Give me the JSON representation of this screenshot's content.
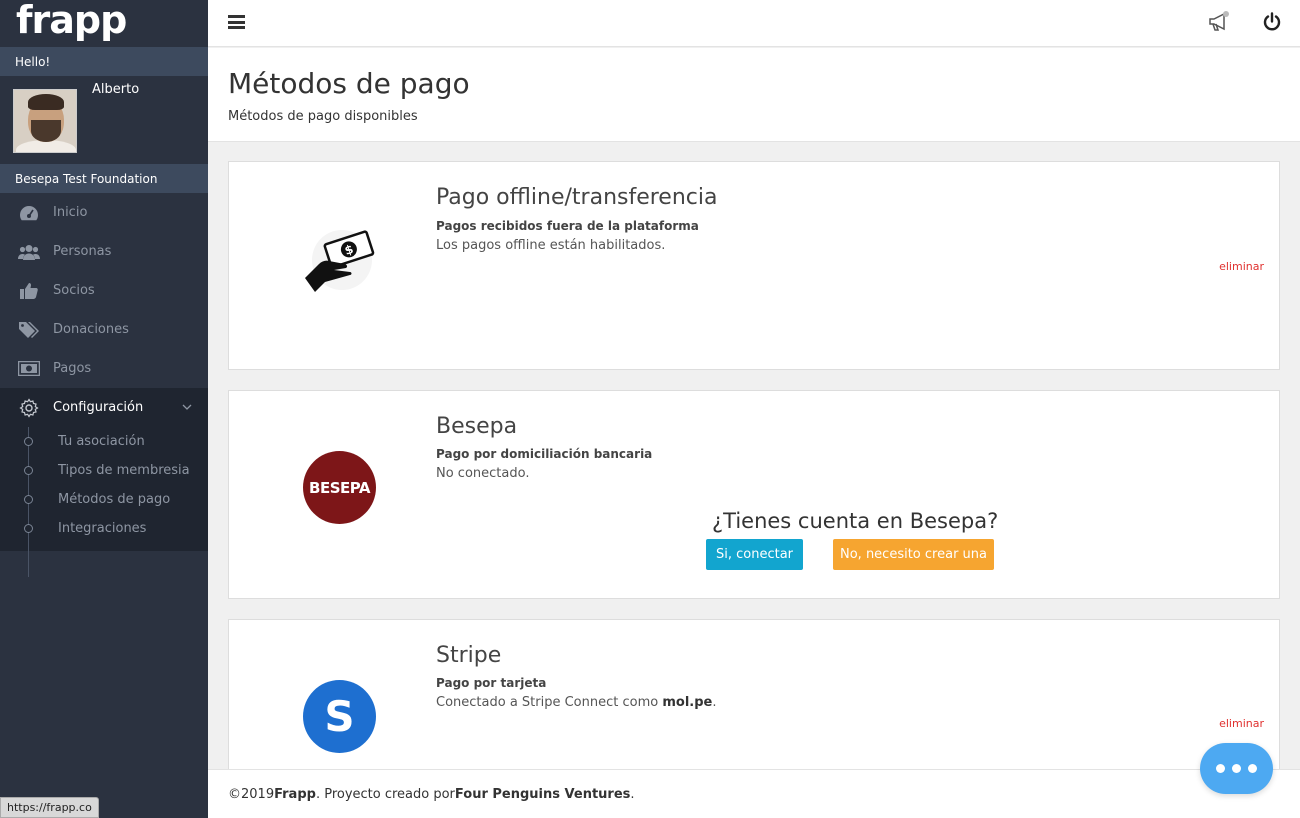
{
  "app": {
    "logo_text": "frapp",
    "hello": "Hello!",
    "user_name": "Alberto",
    "organization": "Besepa Test Foundation"
  },
  "sidebar": {
    "items": [
      {
        "label": "Inicio",
        "icon": "dashboard-icon"
      },
      {
        "label": "Personas",
        "icon": "users-icon"
      },
      {
        "label": "Socios",
        "icon": "thumbs-up-icon"
      },
      {
        "label": "Donaciones",
        "icon": "tags-icon"
      },
      {
        "label": "Pagos",
        "icon": "money-icon"
      },
      {
        "label": "Configuración",
        "icon": "gear-icon"
      }
    ],
    "subitems": [
      {
        "label": "Tu asociación"
      },
      {
        "label": "Tipos de membresia"
      },
      {
        "label": "Métodos de pago"
      },
      {
        "label": "Integraciones"
      }
    ]
  },
  "header": {
    "title": "Métodos de pago",
    "subtitle": "Métodos de pago disponibles"
  },
  "cards": {
    "offline": {
      "title": "Pago offline/transferencia",
      "subtitle": "Pagos recibidos fuera de la plataforma",
      "description": "Los pagos offline están habilitados.",
      "delete_label": "eliminar"
    },
    "besepa": {
      "title": "Besepa",
      "subtitle": "Pago por domiciliación bancaria",
      "description": "No conectado.",
      "logo_text": "BESEPA",
      "question": "¿Tienes cuenta en Besepa?",
      "yes_label": "Si, conectar",
      "no_label": "No, necesito crear una"
    },
    "stripe": {
      "title": "Stripe",
      "subtitle": "Pago por tarjeta",
      "description_prefix": "Conectado a Stripe Connect como ",
      "account": "mol.pe",
      "description_suffix": ".",
      "logo_text": "S",
      "delete_label": "eliminar"
    }
  },
  "footer": {
    "copyright": "©2019 ",
    "brand": "Frapp",
    "middle": ". Proyecto creado por ",
    "company": "Four Penguins Ventures",
    "end": "."
  },
  "status_url": "https://frapp.co",
  "colors": {
    "sidebar_bg": "#2b3240",
    "accent_blue": "#12a5cf",
    "accent_orange": "#f6a530",
    "delete_red": "#e0312f",
    "besepa_red": "#7d1618",
    "stripe_blue": "#1e6fd0"
  }
}
